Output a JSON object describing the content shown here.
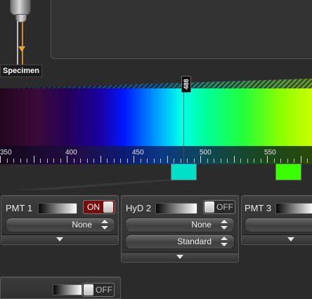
{
  "light_path": {
    "specimen_label": "Specimen"
  },
  "spectrum": {
    "axis_ticks": [
      "350",
      "400",
      "450",
      "500",
      "550"
    ],
    "marker_label": "488",
    "marker_nm": 488
  },
  "detectors": [
    {
      "name": "PMT 1",
      "toggle": "ON",
      "dropdown1": "None",
      "dropdown2": ""
    },
    {
      "name": "HyD 2",
      "toggle": "OFF",
      "dropdown1": "None",
      "dropdown2": "Standard"
    },
    {
      "name": "PMT 3",
      "toggle": "",
      "dropdown1": "",
      "dropdown2": ""
    }
  ],
  "bottom_panel": {
    "toggle": "OFF"
  },
  "colors": {
    "accent_on": "#7a0b0b",
    "swatch_cyan": "#00e0c9",
    "swatch_green": "#39ff00"
  },
  "icons": {
    "objective": "objective-lens-icon",
    "beam": "beam-arrow-icon",
    "select_arrows": "up-down-chevron-icon",
    "expand": "chevron-down-icon"
  }
}
